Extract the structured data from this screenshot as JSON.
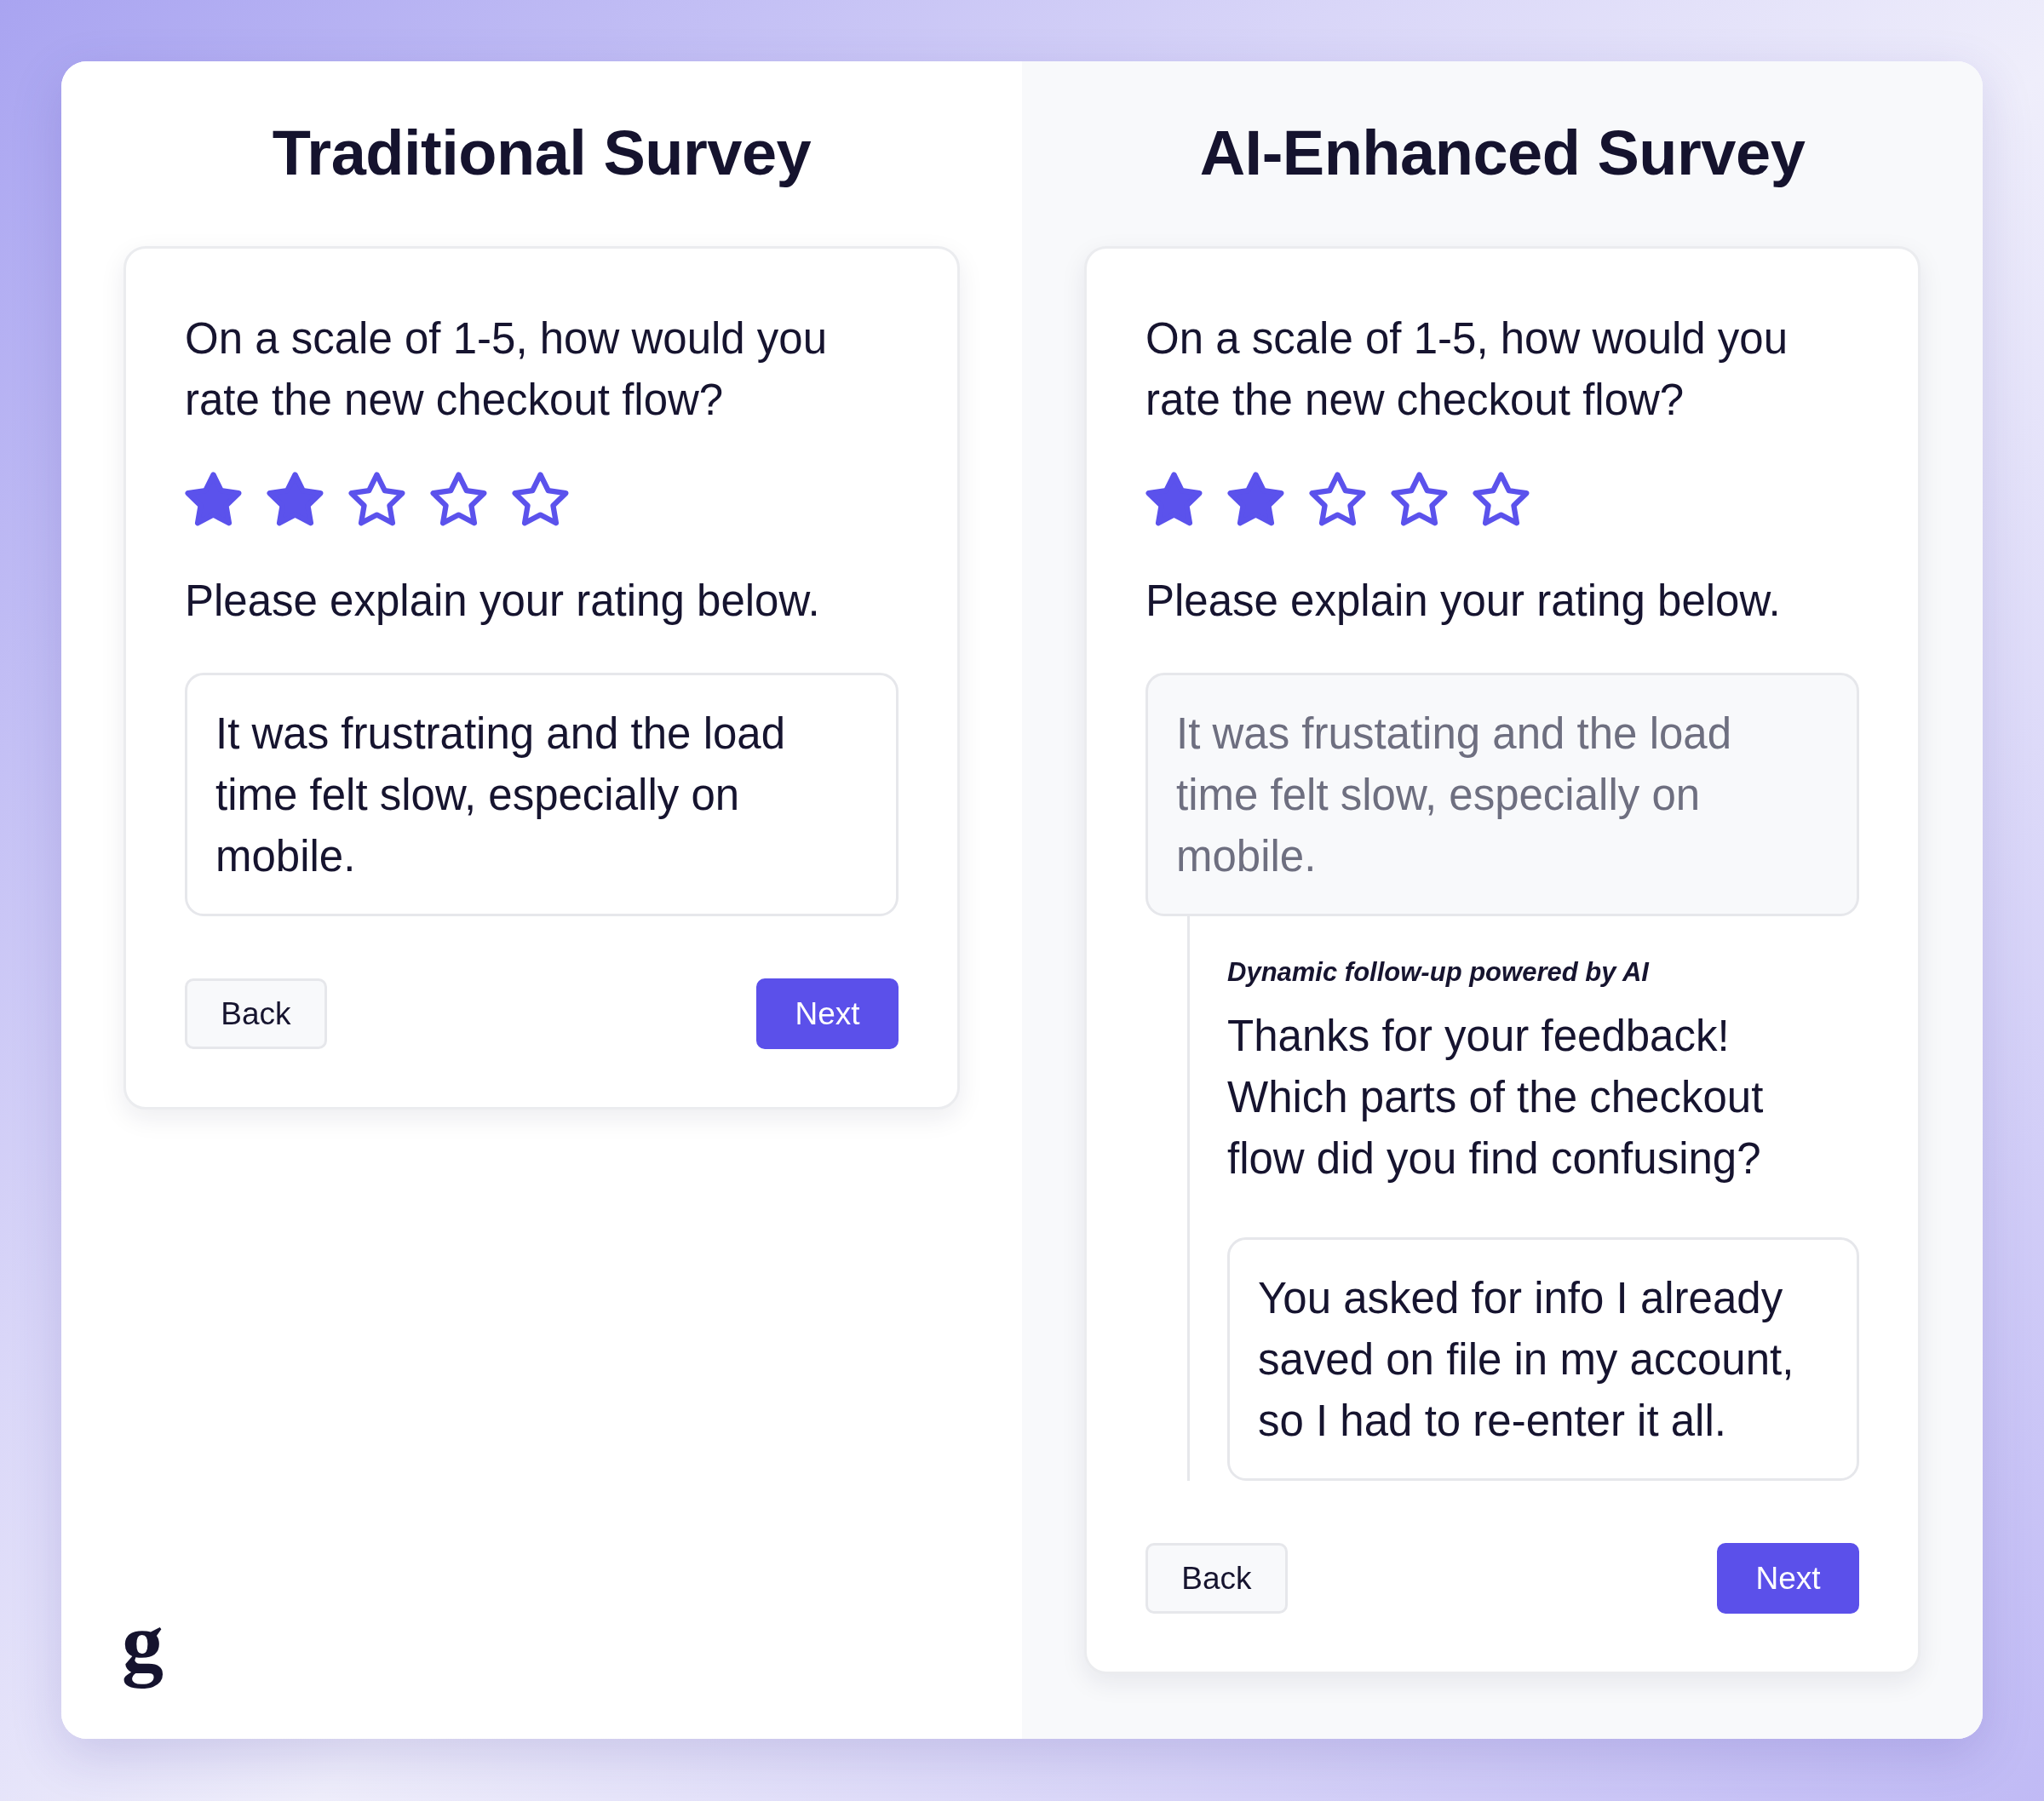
{
  "logo": {
    "text": "g"
  },
  "panels": [
    {
      "kind": "traditional",
      "title": "Traditional Survey",
      "question": "On a scale of 1-5, how would you rate the new checkout flow?",
      "rating": {
        "stars": 2
      },
      "prompt": "Please explain your rating below.",
      "answer": {
        "value": "It was frustrating and the load time felt slow, especially on mobile.",
        "disabled": false
      },
      "buttons": [
        {
          "label": "Back",
          "kind": "secondary"
        },
        {
          "label": "Next",
          "kind": "primary"
        }
      ]
    },
    {
      "kind": "enhanced",
      "title": "AI-Enhanced Survey",
      "question": "On a scale of 1-5, how would you rate the new checkout flow?",
      "rating": {
        "stars": 2
      },
      "prompt": "Please explain your rating below.",
      "answer": {
        "value": "It was frustating and the load time felt slow, especially on mobile.",
        "disabled": true
      },
      "follow_up": {
        "caption": "Dynamic follow-up powered by AI",
        "question": "Thanks for your feedback! Which parts of the checkout flow did you find confusing?",
        "answer": {
          "value": "You asked for info I already saved on file in my account, so I had to re-enter it all.",
          "disabled": false
        }
      },
      "buttons": [
        {
          "label": "Back",
          "kind": "secondary"
        },
        {
          "label": "Next",
          "kind": "primary"
        }
      ]
    }
  ]
}
